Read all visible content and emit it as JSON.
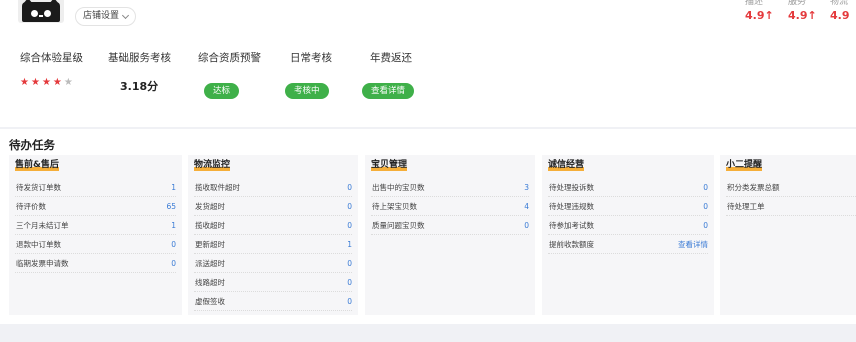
{
  "shop": {
    "settings_label": "店铺设置"
  },
  "scores": [
    {
      "label": "描述",
      "value": "4.9↑"
    },
    {
      "label": "服务",
      "value": "4.9↑"
    },
    {
      "label": "物流",
      "value": "4.9"
    }
  ],
  "metrics": {
    "rating": {
      "label": "综合体验星级",
      "stars_on": 4,
      "stars_total": 5
    },
    "basic_service": {
      "label": "基础服务考核",
      "value": "3.18分"
    },
    "qualification": {
      "label": "综合资质预警",
      "badge": "达标"
    },
    "daily": {
      "label": "日常考核",
      "badge": "考核中"
    },
    "annual": {
      "label": "年费返还",
      "badge": "查看详情"
    }
  },
  "colors": {
    "accent_red": "#e4393c",
    "badge_green": "#3fb049",
    "link_blue": "#3a7bd5",
    "title_underline": "#f5a623"
  },
  "todo": {
    "title": "待办任务",
    "panels": [
      {
        "title": "售前&售后",
        "rows": [
          {
            "label": "待发货订单数",
            "count": "1"
          },
          {
            "label": "待评价数",
            "count": "65"
          },
          {
            "label": "三个月未结订单",
            "count": "1"
          },
          {
            "label": "退款中订单数",
            "count": "0"
          },
          {
            "label": "临期发票申请数",
            "count": "0"
          }
        ]
      },
      {
        "title": "物流监控",
        "rows": [
          {
            "label": "揽收取件超时",
            "count": "0"
          },
          {
            "label": "发货超时",
            "count": "0"
          },
          {
            "label": "揽收超时",
            "count": "0"
          },
          {
            "label": "更新超时",
            "count": "1"
          },
          {
            "label": "派送超时",
            "count": "0"
          },
          {
            "label": "线路超时",
            "count": "0"
          },
          {
            "label": "虚假签收",
            "count": "0"
          }
        ]
      },
      {
        "title": "宝贝管理",
        "rows": [
          {
            "label": "出售中的宝贝数",
            "count": "3"
          },
          {
            "label": "待上架宝贝数",
            "count": "4"
          },
          {
            "label": "质量问题宝贝数",
            "count": "0"
          }
        ]
      },
      {
        "title": "诚信经营",
        "rows": [
          {
            "label": "待处理投诉数",
            "count": "0"
          },
          {
            "label": "待处理违规数",
            "count": "0"
          },
          {
            "label": "待参加考试数",
            "count": "0"
          },
          {
            "label": "提前收款额度",
            "count": "查看详情"
          }
        ]
      },
      {
        "title": "小二提醒",
        "rows": [
          {
            "label": "积分类发票总额",
            "count": ""
          },
          {
            "label": "待处理工单",
            "count": ""
          }
        ]
      }
    ]
  }
}
